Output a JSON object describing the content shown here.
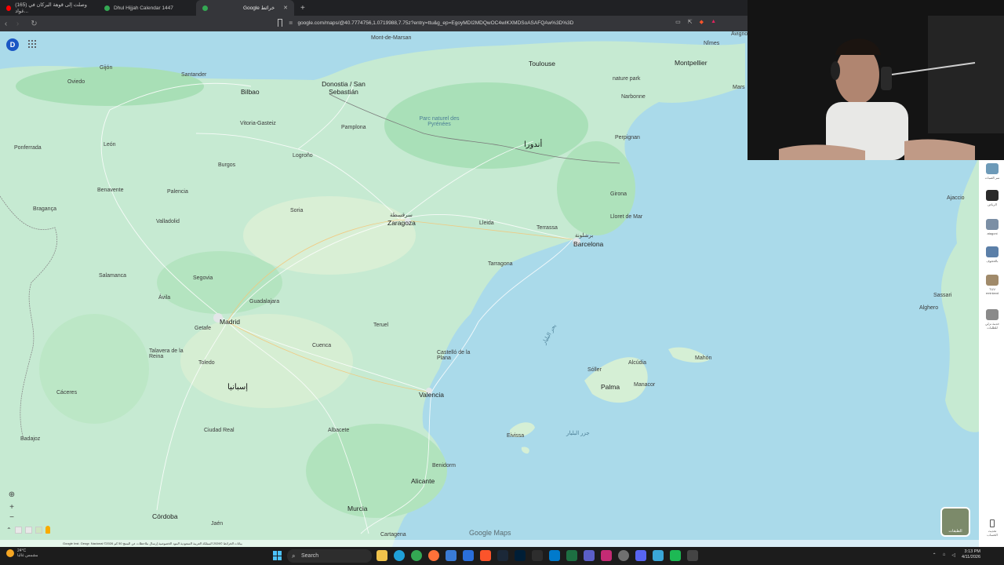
{
  "browser": {
    "tabs": [
      {
        "label": "(165) وصلت إلى قوهة البركان في غواد...",
        "color": "#ff0000"
      },
      {
        "label": "Dhul Hijjah Calendar 1447",
        "color": "#34a853"
      },
      {
        "label": "Google خرائط",
        "color": "#34a853",
        "active": true
      }
    ],
    "new_tab_label": "+",
    "url_prefix": "≣",
    "url": "google.com/maps/@40.7774756,1.0719988,7.75z?entry=ttu&g_ep=EgoyMDI2MDQwOC4wIKXMDSoASAFQAw%3D%3D"
  },
  "map": {
    "account_initial": "D",
    "labels": {
      "mont_de_marsan": "Mont-de-Marsan",
      "toulouse": "Toulouse",
      "montpellier": "Montpellier",
      "nimes": "Nîmes",
      "marseille": "Mars",
      "avignon": "Avignon",
      "narbonne": "Narbonne",
      "perpignan": "Perpignan",
      "oviedo": "Oviedo",
      "gijon": "Gijón",
      "santander": "Santander",
      "bilbao": "Bilbao",
      "donostia": "Donostia / San Sebastián",
      "vitoria": "Vitoria-Gasteiz",
      "pamplona": "Pamplona",
      "leon": "León",
      "ponferrada": "Ponferrada",
      "burgos": "Burgos",
      "logrono": "Logroño",
      "andorra": "أندورا",
      "girona": "Girona",
      "lloret": "Lloret de Mar",
      "braganca": "Bragança",
      "benavente": "Benavente",
      "palencia": "Palencia",
      "valladolid": "Valladolid",
      "soria": "Soria",
      "zaragoza": "Zaragoza",
      "zaragoza_ar": "سرقسطة",
      "lleida": "Lleida",
      "terrassa": "Terrassa",
      "barcelona": "Barcelona",
      "barcelona_ar": "برشلونة",
      "tarragona": "Tarragona",
      "salamanca": "Salamanca",
      "segovia": "Segovia",
      "avila": "Ávila",
      "guadalajara": "Guadalajara",
      "madrid": "Madrid",
      "getafe": "Getafe",
      "teruel": "Teruel",
      "cuenca": "Cuenca",
      "castellon": "Castelló de la Plana",
      "toledo": "Toledo",
      "talavera": "Talavera de la Reina",
      "spain_ar": "إسبانيا",
      "caceres": "Cáceres",
      "valencia": "Valencia",
      "ciudad_real": "Ciudad Real",
      "albacete": "Albacete",
      "badajoz": "Badajoz",
      "benidorm": "Benidorm",
      "alicante": "Alicante",
      "murcia": "Murcia",
      "cordoba": "Córdoba",
      "jaen": "Jaén",
      "cartagena": "Cartagena",
      "palma": "Palma",
      "ibiza": "Eivissa",
      "menorca": "Mahón",
      "sassari": "Sassari",
      "alghero": "Alghero",
      "balearic_sea": "بحر البليار",
      "balearic_islands": "جزر البليار",
      "ajaccio": "Ajaccio",
      "manacor": "Manacor",
      "soller": "Sóller",
      "alcudia": "Alcúdia",
      "nature_park": "nature park",
      "pyrenees": "Parc naturel des Pyrénées"
    },
    "layers_label": "الطبقات",
    "logo": "Google Maps",
    "attribution": "Google  Inst. Geogr. Nacional  ©2026  بيانات الخرائط  ©2026  المملكة العربية السعودية  البنود  الخصوصية  إرسال ملاحظات عن المنتج  50 كم"
  },
  "side_panel": {
    "items": [
      {
        "text": "سر الصبات",
        "color": "#6d9ab8"
      },
      {
        "text": "الرياض",
        "color": "#2a2a2a"
      },
      {
        "text": "atagoni",
        "color": "#7b8fa5"
      },
      {
        "text": "بالحجوف",
        "color": "#5b7fa8"
      },
      {
        "text": "TUV eminland",
        "color": "#a08a6a"
      },
      {
        "text": "خدمة نزلي للطلبات",
        "color": "#8a8a8a"
      }
    ],
    "bottom_text": "تحديث الحساب"
  },
  "taskbar": {
    "weather_temp": "24°C",
    "weather_desc": "مشمس غالبا",
    "search_label": "Search",
    "time": "3:13 PM",
    "date": "4/11/2026"
  }
}
